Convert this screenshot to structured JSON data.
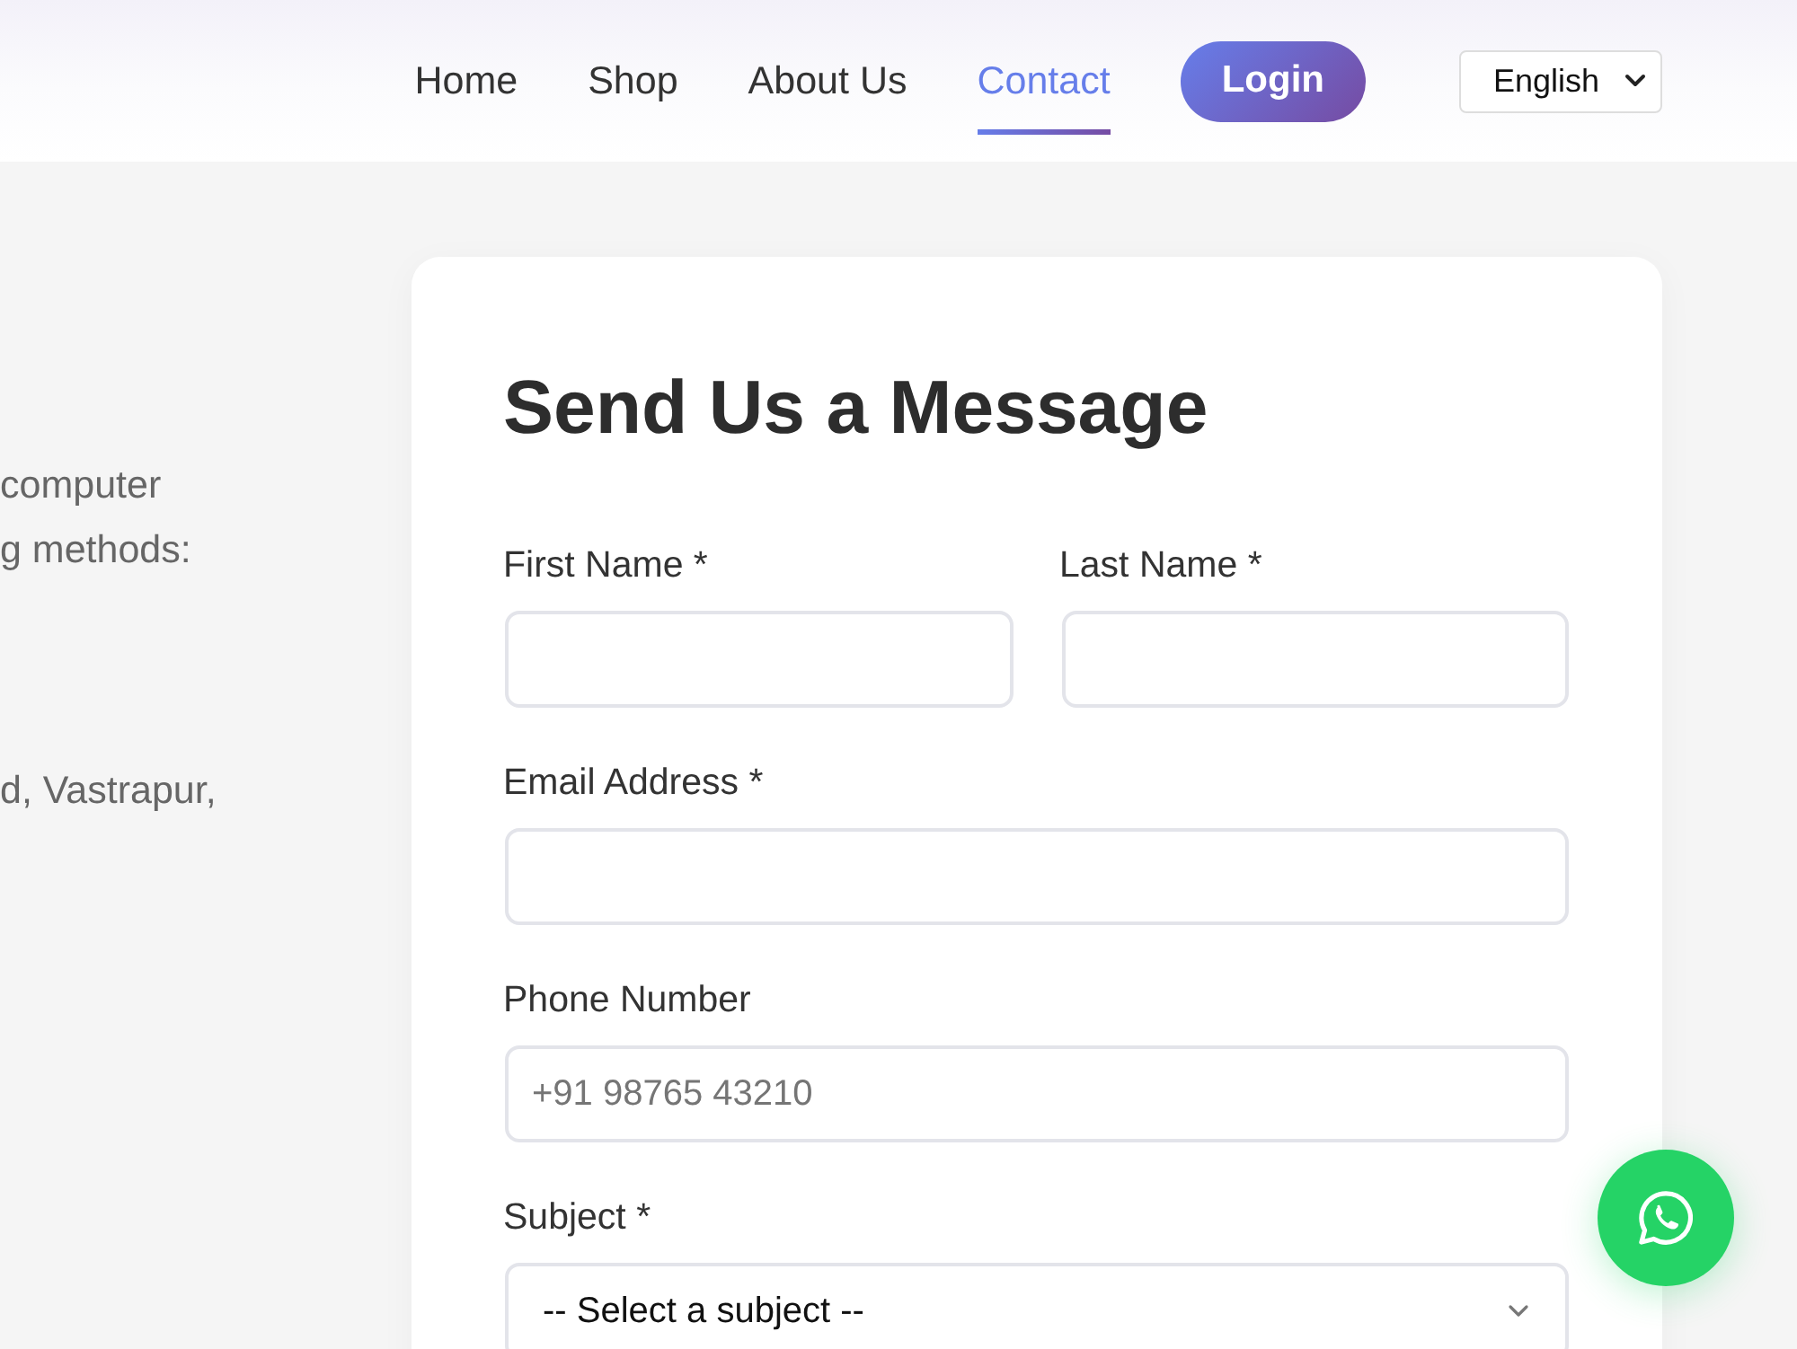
{
  "header": {
    "nav": [
      {
        "label": "Home",
        "selected": false
      },
      {
        "label": "Shop",
        "selected": false
      },
      {
        "label": "About Us",
        "selected": false
      },
      {
        "label": "Contact",
        "selected": true
      }
    ],
    "login_button": "Login",
    "language_select": {
      "value": "English"
    }
  },
  "left_column": {
    "intro_lines": [
      "computer",
      "g methods:"
    ],
    "address_line": "d, Vastrapur,"
  },
  "contact_form": {
    "title": "Send Us a Message",
    "rows": [
      {
        "fields": [
          {
            "kind": "text",
            "label": "First Name *"
          },
          {
            "kind": "text",
            "label": "Last Name *"
          }
        ]
      },
      {
        "fields": [
          {
            "kind": "text",
            "label": "Email Address *"
          }
        ]
      },
      {
        "fields": [
          {
            "kind": "text",
            "label": "Phone Number",
            "placeholder": "+91 98765 43210"
          }
        ]
      },
      {
        "fields": [
          {
            "kind": "select",
            "label": "Subject *",
            "value": "-- Select a subject --"
          }
        ]
      }
    ]
  }
}
